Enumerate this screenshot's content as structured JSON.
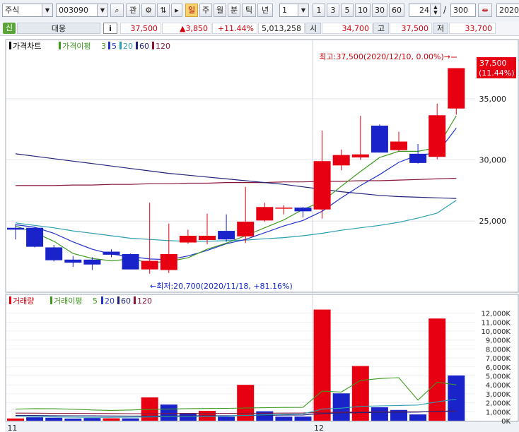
{
  "toolbar": {
    "market_type": "주식",
    "code": "003090",
    "btn_search_glyph": "⌕",
    "btn_interest": "관",
    "btn_spinner": "⇅",
    "periods": [
      "일",
      "주",
      "월",
      "분",
      "틱",
      "년"
    ],
    "active_period": "일",
    "interval_value": "1",
    "quick_intervals": [
      "1",
      "3",
      "5",
      "10",
      "30",
      "60"
    ],
    "view_count": "24",
    "slash": "/",
    "total_count": "300",
    "date": "2020/"
  },
  "quote": {
    "credit_badge": "신",
    "name": "대웅",
    "info_icon": "i",
    "price": "37,500",
    "change": "▲3,850",
    "change_pct": "+11.44%",
    "volume": "5,013,258",
    "open_label": "시",
    "open": "34,700",
    "high_label": "고",
    "high": "37,500",
    "low_label": "저",
    "low": "33,700"
  },
  "colors": {
    "up": "#e60012",
    "down": "#1a23c9",
    "ma3": "#3f9a1f",
    "ma5": "#2233cc",
    "ma20": "#2b9fb0",
    "ma60": "#22227a",
    "ma120": "#8a1538"
  },
  "chart_data": [
    {
      "type": "candlestick",
      "legend": [
        "가격차트",
        "가격이평",
        "3",
        "5",
        "20",
        "60",
        "120"
      ],
      "x_tick_labels": [
        {
          "label": "11",
          "index": 0
        },
        {
          "label": "12",
          "index": 16
        }
      ],
      "y_ticks": [
        25000,
        30000,
        35000
      ],
      "y_tick_labels": [
        "25,000",
        "30,000",
        "35,000"
      ],
      "ylim": [
        19300,
        38800
      ],
      "current_price_label": "37,500",
      "current_pct_label": "(11.44%)",
      "max_annotation": "최고:37,500(2020/12/10, 0.00%)→",
      "min_annotation": "←최저:20,700(2020/11/18, +81.16%)",
      "candles": [
        {
          "open": 24450,
          "high": 24750,
          "low": 23500,
          "close": 24300
        },
        {
          "open": 24450,
          "high": 24500,
          "low": 22850,
          "close": 22900
        },
        {
          "open": 22850,
          "high": 23050,
          "low": 21700,
          "close": 21800
        },
        {
          "open": 21850,
          "high": 22150,
          "low": 21250,
          "close": 21600
        },
        {
          "open": 21850,
          "high": 22050,
          "low": 21000,
          "close": 21450
        },
        {
          "open": 22500,
          "high": 22700,
          "low": 22050,
          "close": 22250
        },
        {
          "open": 22300,
          "high": 22350,
          "low": 21150,
          "close": 21050
        },
        {
          "open": 21050,
          "high": 26500,
          "low": 20700,
          "close": 21750
        },
        {
          "open": 21000,
          "high": 24800,
          "low": 20750,
          "close": 22300
        },
        {
          "open": 23250,
          "high": 24300,
          "low": 23150,
          "close": 23800
        },
        {
          "open": 23450,
          "high": 25600,
          "low": 23100,
          "close": 23800
        },
        {
          "open": 24200,
          "high": 25550,
          "low": 23300,
          "close": 23500
        },
        {
          "open": 23750,
          "high": 27800,
          "low": 23200,
          "close": 24950
        },
        {
          "open": 25050,
          "high": 26500,
          "low": 24950,
          "close": 26150
        },
        {
          "open": 26050,
          "high": 26300,
          "low": 25550,
          "close": 26100
        },
        {
          "open": 26100,
          "high": 26150,
          "low": 25300,
          "close": 25800
        },
        {
          "open": 25950,
          "high": 32400,
          "low": 25200,
          "close": 29900
        },
        {
          "open": 29550,
          "high": 30850,
          "low": 29150,
          "close": 30400
        },
        {
          "open": 30200,
          "high": 33600,
          "low": 30000,
          "close": 30450
        },
        {
          "open": 32800,
          "high": 32900,
          "low": 30650,
          "close": 30600
        },
        {
          "open": 30800,
          "high": 32300,
          "low": 30700,
          "close": 31500
        },
        {
          "open": 30500,
          "high": 31300,
          "low": 29700,
          "close": 29750
        },
        {
          "open": 30250,
          "high": 34600,
          "low": 30050,
          "close": 33650
        },
        {
          "open": 34200,
          "high": 37500,
          "low": 33700,
          "close": 37500
        }
      ],
      "ma3": [
        24600,
        24050,
        23350,
        22350,
        21950,
        21750,
        21900,
        21600,
        21700,
        22000,
        22700,
        23200,
        23800,
        24450,
        25100,
        25950,
        26600,
        27850,
        29050,
        30200,
        30700,
        30700,
        31000,
        33600
      ],
      "ma5": [
        24700,
        24500,
        24000,
        23300,
        22700,
        22300,
        22100,
        21900,
        21850,
        22150,
        22600,
        23150,
        23500,
        24050,
        24600,
        25050,
        25800,
        26900,
        27900,
        28800,
        29800,
        30400,
        30550,
        32600
      ],
      "ma20": [
        24850,
        24650,
        24450,
        24200,
        24000,
        23800,
        23600,
        23500,
        23400,
        23350,
        23350,
        23400,
        23450,
        23550,
        23650,
        23800,
        24000,
        24250,
        24450,
        24650,
        24900,
        25250,
        25650,
        26700
      ],
      "ma60": [
        30500,
        30300,
        30100,
        29900,
        29700,
        29500,
        29300,
        29100,
        28900,
        28750,
        28600,
        28450,
        28300,
        28150,
        28000,
        27800,
        27600,
        27400,
        27250,
        27100,
        27000,
        26950,
        26900,
        26850
      ],
      "ma120": [
        27900,
        27900,
        27900,
        27950,
        27950,
        28000,
        28000,
        28050,
        28050,
        28100,
        28100,
        28150,
        28150,
        28150,
        28200,
        28200,
        28250,
        28250,
        28300,
        28300,
        28350,
        28400,
        28450,
        28500
      ]
    },
    {
      "type": "bar",
      "legend": [
        "거래량",
        "거래이평",
        "5",
        "20",
        "60",
        "120"
      ],
      "y_ticks": [
        0,
        1000000,
        2000000,
        3000000,
        4000000,
        5000000,
        6000000,
        7000000,
        8000000,
        9000000,
        10000000,
        11000000,
        12000000
      ],
      "y_tick_labels": [
        "0K",
        "1,000K",
        "2,000K",
        "3,000K",
        "4,000K",
        "5,000K",
        "6,000K",
        "7,000K",
        "8,000K",
        "9,000K",
        "10,000K",
        "11,000K",
        "12,000K"
      ],
      "ylim": [
        0,
        12600000
      ],
      "volumes": [
        250000,
        380000,
        330000,
        240000,
        300000,
        270000,
        260000,
        2600000,
        1800000,
        860000,
        1100000,
        450000,
        4000000,
        1050000,
        450000,
        460000,
        12400000,
        3050000,
        6100000,
        1500000,
        1200000,
        700000,
        11400000,
        5050000
      ],
      "up_flags": [
        true,
        false,
        false,
        false,
        false,
        true,
        false,
        true,
        false,
        false,
        true,
        false,
        true,
        false,
        false,
        false,
        true,
        false,
        true,
        false,
        false,
        false,
        true,
        false
      ],
      "vma5": [
        1300000,
        1350000,
        1330000,
        1280000,
        1200000,
        1150000,
        1200000,
        1250000,
        1300000,
        1350000,
        1360000,
        1380000,
        1420000,
        1450000,
        1480000,
        1490000,
        3300000,
        3200000,
        4500000,
        4700000,
        4800000,
        2300000,
        4300000,
        4000000
      ],
      "vma20": [
        480000,
        450000,
        420000,
        400000,
        380000,
        380000,
        390000,
        420000,
        450000,
        470000,
        490000,
        520000,
        600000,
        650000,
        700000,
        750000,
        1300000,
        1400000,
        1600000,
        1650000,
        1700000,
        1750000,
        2100000,
        2400000
      ],
      "vma60": [
        600000,
        580000,
        560000,
        550000,
        540000,
        530000,
        520000,
        520000,
        530000,
        540000,
        550000,
        560000,
        580000,
        600000,
        620000,
        640000,
        800000,
        850000,
        900000,
        920000,
        940000,
        960000,
        1050000,
        1100000
      ],
      "vma120": [
        850000,
        840000,
        830000,
        820000,
        810000,
        800000,
        790000,
        790000,
        800000,
        800000,
        810000,
        820000,
        830000,
        840000,
        850000,
        860000,
        920000,
        940000,
        960000,
        970000,
        980000,
        990000,
        1020000,
        1050000
      ]
    }
  ]
}
